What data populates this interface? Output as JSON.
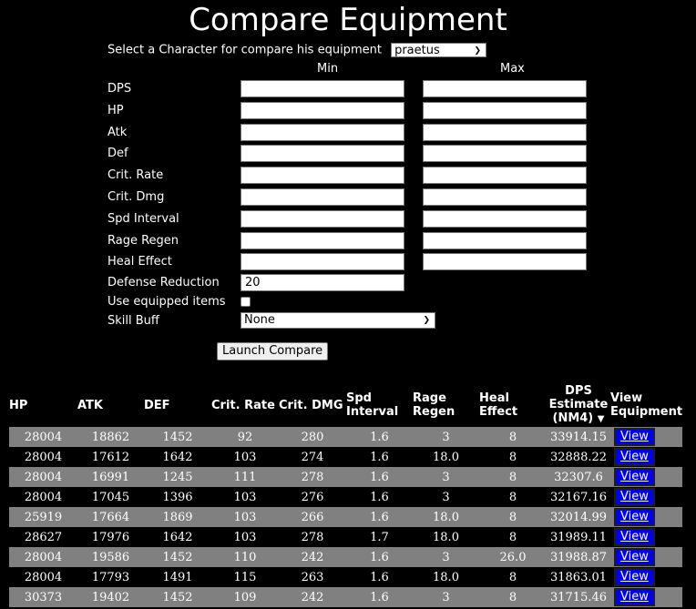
{
  "title": "Compare Equipment",
  "character_select": {
    "label": "Select a Character for compare his equipment",
    "value": "praetus"
  },
  "columns": {
    "min": "Min",
    "max": "Max"
  },
  "stat_filters": [
    {
      "label": "DPS",
      "min": "",
      "max": ""
    },
    {
      "label": "HP",
      "min": "",
      "max": ""
    },
    {
      "label": "Atk",
      "min": "",
      "max": ""
    },
    {
      "label": "Def",
      "min": "",
      "max": ""
    },
    {
      "label": "Crit. Rate",
      "min": "",
      "max": ""
    },
    {
      "label": "Crit. Dmg",
      "min": "",
      "max": ""
    },
    {
      "label": "Spd Interval",
      "min": "",
      "max": ""
    },
    {
      "label": "Rage Regen",
      "min": "",
      "max": ""
    },
    {
      "label": "Heal Effect",
      "min": "",
      "max": ""
    }
  ],
  "defense_reduction": {
    "label": "Defense Reduction",
    "value": "20"
  },
  "use_equipped": {
    "label": "Use equipped items",
    "checked": false
  },
  "skill_buff": {
    "label": "Skill Buff",
    "value": "None"
  },
  "launch_button": "Launch Compare",
  "results": {
    "headers": [
      "HP",
      "ATK",
      "DEF",
      "Crit. Rate",
      "Crit. DMG",
      "Spd Interval",
      "Rage Regen",
      "Heal Effect",
      "DPS Estimate (NM4)",
      "View Equipment"
    ],
    "sort_indicator": "▼",
    "view_label": "View",
    "rows": [
      [
        "28004",
        "18862",
        "1452",
        "92",
        "280",
        "1.6",
        "3",
        "8",
        "33914.15"
      ],
      [
        "28004",
        "17612",
        "1642",
        "103",
        "274",
        "1.6",
        "18.0",
        "8",
        "32888.22"
      ],
      [
        "28004",
        "16991",
        "1245",
        "111",
        "278",
        "1.6",
        "3",
        "8",
        "32307.6"
      ],
      [
        "28004",
        "17045",
        "1396",
        "103",
        "276",
        "1.6",
        "3",
        "8",
        "32167.16"
      ],
      [
        "25919",
        "17664",
        "1869",
        "103",
        "266",
        "1.6",
        "18.0",
        "8",
        "32014.99"
      ],
      [
        "28627",
        "17976",
        "1642",
        "103",
        "278",
        "1.7",
        "18.0",
        "8",
        "31989.11"
      ],
      [
        "28004",
        "19586",
        "1452",
        "110",
        "242",
        "1.6",
        "3",
        "26.0",
        "31988.87"
      ],
      [
        "28004",
        "17793",
        "1491",
        "115",
        "263",
        "1.6",
        "18.0",
        "8",
        "31863.01"
      ],
      [
        "30373",
        "19402",
        "1452",
        "109",
        "242",
        "1.6",
        "3",
        "8",
        "31715.46"
      ]
    ]
  }
}
